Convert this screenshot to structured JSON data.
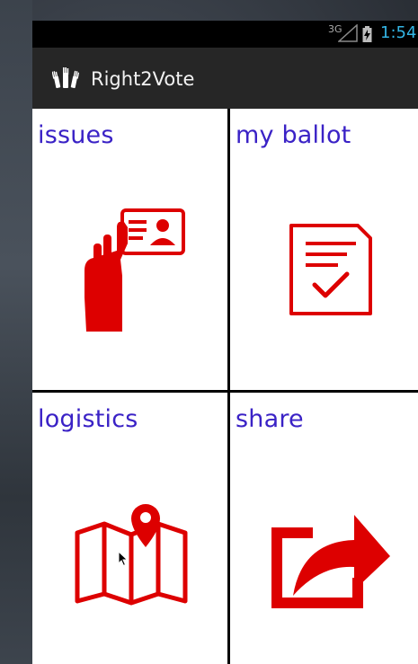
{
  "status_bar": {
    "network": "3G",
    "time": "1:54",
    "accent_color": "#33b5e5"
  },
  "action_bar": {
    "title": "Right2Vote",
    "icon": "raised-hands-icon"
  },
  "tiles": [
    {
      "label": "issues",
      "icon": "id-card-in-hand-icon"
    },
    {
      "label": "my ballot",
      "icon": "ballot-checkmark-icon"
    },
    {
      "label": "logistics",
      "icon": "map-pin-icon"
    },
    {
      "label": "share",
      "icon": "share-arrow-icon"
    }
  ],
  "colors": {
    "tile_label": "#3a22c6",
    "icon_red": "#dd0000",
    "action_bar": "#262626"
  }
}
